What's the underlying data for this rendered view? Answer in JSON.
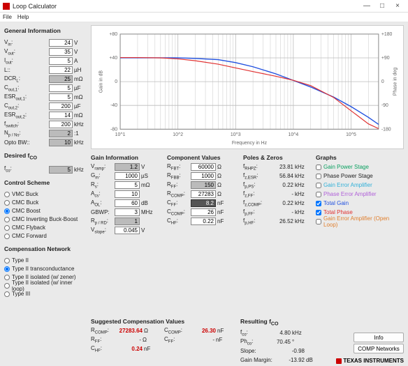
{
  "window": {
    "title": "Loop Calculator",
    "min": "—",
    "max": "□",
    "close": "×"
  },
  "menu": {
    "file": "File",
    "help": "Help"
  },
  "left": {
    "gen_title": "General Information",
    "vin": {
      "lbl": "V",
      "sub": "in",
      "val": "24",
      "unit": "V"
    },
    "vout": {
      "lbl": "V",
      "sub": "out",
      "val": "35",
      "unit": "V"
    },
    "iout": {
      "lbl": "I",
      "sub": "out",
      "val": "5",
      "unit": "A"
    },
    "L": {
      "lbl": "L:",
      "sub": "",
      "val": "22",
      "unit": "µH"
    },
    "dcr": {
      "lbl": "DCR",
      "sub": "L",
      "val": "25",
      "unit": "mΩ",
      "dim": true
    },
    "co1": {
      "lbl": "C",
      "sub": "out,1",
      "val": "5",
      "unit": "µF"
    },
    "esr1": {
      "lbl": "ESR",
      "sub": "out,1",
      "val": "5",
      "unit": "mΩ"
    },
    "co2": {
      "lbl": "C",
      "sub": "out,2",
      "val": "200",
      "unit": "µF"
    },
    "esr2": {
      "lbl": "ESR",
      "sub": "out,2",
      "val": "14",
      "unit": "mΩ"
    },
    "fsw": {
      "lbl": "f",
      "sub": "switch",
      "val": "200",
      "unit": "kHz"
    },
    "npns": {
      "lbl": "N",
      "sub": "p / Ns",
      "val": "2",
      "unit": ":1",
      "dim": true
    },
    "opto": {
      "lbl": "Opto BW:",
      "sub": "",
      "val": "10",
      "unit": "kHz",
      "dim": true
    },
    "fco_title": "Desired f",
    "fco_sub": "CO",
    "fco": {
      "lbl": "f",
      "sub": "co",
      "val": "5",
      "unit": "kHz",
      "dim": true
    },
    "ctrl_title": "Control Scheme",
    "ctrl_opts": [
      "VMC Buck",
      "CMC Buck",
      "CMC Boost",
      "CMC Inverting Buck-Boost",
      "CMC Flyback",
      "CMC Forward"
    ],
    "ctrl_sel": 2,
    "comp_title": "Compensation Network",
    "comp_opts": [
      "Type II",
      "Type II transconductance",
      "Type II isolated (w/ zener)",
      "Type II isolated (w/ inner loop)",
      "Type III"
    ],
    "comp_sel": 1
  },
  "gain": {
    "title": "Gain Information",
    "vramp": {
      "lbl": "V",
      "sub": "ramp",
      "val": "1.2",
      "unit": "V",
      "dim": true
    },
    "gm": {
      "lbl": "G",
      "sub": "m",
      "val": "1000",
      "unit": "µS"
    },
    "rs": {
      "lbl": "R",
      "sub": "s",
      "val": "5",
      "unit": "mΩ"
    },
    "acs": {
      "lbl": "A",
      "sub": "cs",
      "val": "10",
      "unit": ""
    },
    "aol": {
      "lbl": "A",
      "sub": "OL",
      "val": "60",
      "unit": "dB"
    },
    "gbwp": {
      "lbl": "GBWP:",
      "sub": "",
      "val": "3",
      "unit": "MHz"
    },
    "rprd": {
      "lbl": "R",
      "sub": "p / RD",
      "val": "1",
      "unit": "",
      "dim": true
    },
    "vslope": {
      "lbl": "V",
      "sub": "slope",
      "val": "0.045",
      "unit": "V"
    }
  },
  "compv": {
    "title": "Component Values",
    "rfbt": {
      "lbl": "R",
      "sub": "FBT",
      "val": "60000",
      "unit": "Ω"
    },
    "rfbb": {
      "lbl": "R",
      "sub": "FBB",
      "val": "1000",
      "unit": "Ω"
    },
    "rff": {
      "lbl": "R",
      "sub": "FF",
      "val": "150",
      "unit": "Ω",
      "dim": true
    },
    "rcomp": {
      "lbl": "R",
      "sub": "COMP",
      "val": "27283",
      "unit": "Ω"
    },
    "cff": {
      "lbl": "C",
      "sub": "FF",
      "val": "8.2",
      "unit": "nF",
      "dark": true
    },
    "ccomp": {
      "lbl": "C",
      "sub": "COMP",
      "val": "26",
      "unit": "nF"
    },
    "chf": {
      "lbl": "C",
      "sub": "HF",
      "val": "0.22",
      "unit": "nF"
    }
  },
  "pz": {
    "title": "Poles & Zeros",
    "rhpz": {
      "lbl": "f",
      "sub": "RHPZ",
      "val": "23.81",
      "unit": "kHz"
    },
    "zesr": {
      "lbl": "f",
      "sub": "z,ESR",
      "val": "56.84",
      "unit": "kHz"
    },
    "pps": {
      "lbl": "f",
      "sub": "p,PS",
      "val": "0.22",
      "unit": "kHz"
    },
    "zff": {
      "lbl": "f",
      "sub": "z,FF",
      "val": "-",
      "unit": "kHz"
    },
    "zcomp": {
      "lbl": "f",
      "sub": "z,COMP",
      "val": "0.22",
      "unit": "kHz"
    },
    "pff": {
      "lbl": "f",
      "sub": "p,FF",
      "val": "-",
      "unit": "kHz"
    },
    "phf": {
      "lbl": "f",
      "sub": "p,HF",
      "val": "26.52",
      "unit": "kHz"
    }
  },
  "graphs": {
    "title": "Graphs",
    "items": [
      {
        "label": "Gain Power Stage",
        "color": "#0aa060",
        "checked": false
      },
      {
        "label": "Phase Power Stage",
        "color": "#222",
        "checked": false
      },
      {
        "label": "Gain Error Amplifier",
        "color": "#30b0d8",
        "checked": false
      },
      {
        "label": "Phase Error Amplifier",
        "color": "#b060d8",
        "checked": false
      },
      {
        "label": "Total Gain",
        "color": "#2050e0",
        "checked": true
      },
      {
        "label": "Total Phase",
        "color": "#e03030",
        "checked": true
      },
      {
        "label": "Gain Error Amplifier (Open Loop)",
        "color": "#e08030",
        "checked": false
      }
    ]
  },
  "sugg": {
    "title": "Suggested Compensation Values",
    "rcomp": {
      "lbl": "R",
      "sub": "COMP",
      "val": "27283.64",
      "unit": "Ω"
    },
    "rff": {
      "lbl": "R",
      "sub": "FF",
      "val": "-",
      "unit": "Ω"
    },
    "chf": {
      "lbl": "C",
      "sub": "HF",
      "val": "0.24",
      "unit": "nF"
    },
    "ccomp": {
      "lbl": "C",
      "sub": "COMP",
      "val": "26.30",
      "unit": "nF"
    },
    "cff": {
      "lbl": "C",
      "sub": "FF",
      "val": "-",
      "unit": "nF"
    }
  },
  "res": {
    "title": "Resulting f",
    "title_sub": "CO",
    "fco": {
      "lbl": "f",
      "sub": "co",
      "val": "4.80",
      "unit": "kHz"
    },
    "phco": {
      "lbl": "Ph",
      "sub": "co",
      "val": "70.45",
      "unit": "°"
    },
    "slope": {
      "lbl": "Slope:",
      "val": "-0.98",
      "unit": ""
    },
    "gm": {
      "lbl": "Gain Margin:",
      "val": "-13.92",
      "unit": "dB"
    }
  },
  "buttons": {
    "info": "Info",
    "compnet": "COMP Networks"
  },
  "brand": "TEXAS INSTRUMENTS",
  "chart_data": {
    "type": "line",
    "xlabel": "Frequency in Hz",
    "ylabel_left": "Gain in dB",
    "ylabel_right": "Phase in deg",
    "x_log": true,
    "xlim": [
      10,
      300000
    ],
    "ylim_left": [
      -80,
      80
    ],
    "ylim_right": [
      -180,
      180
    ],
    "x_ticks": [
      "10^1",
      "10^2",
      "10^3",
      "10^4",
      "10^5"
    ],
    "y_left_ticks": [
      -80,
      -40,
      0,
      40,
      80
    ],
    "y_right_ticks": [
      -180,
      -90,
      0,
      90,
      180
    ],
    "series": [
      {
        "name": "Total Gain",
        "axis": "left",
        "x": [
          10,
          20,
          50,
          100,
          200,
          500,
          1000,
          2000,
          5000,
          10000,
          20000,
          50000,
          100000,
          200000,
          300000
        ],
        "y": [
          40,
          40,
          40,
          40,
          39,
          37,
          32,
          25,
          13,
          2,
          -9,
          -26,
          -42,
          -60,
          -72
        ]
      },
      {
        "name": "Total Phase",
        "axis": "right",
        "x": [
          10,
          20,
          50,
          100,
          200,
          500,
          1000,
          2000,
          5000,
          10000,
          20000,
          50000,
          100000,
          200000,
          300000
        ],
        "y": [
          91,
          91,
          90,
          86,
          79,
          66,
          52,
          38,
          20,
          5,
          -15,
          -60,
          -110,
          -160,
          -178
        ]
      }
    ]
  }
}
